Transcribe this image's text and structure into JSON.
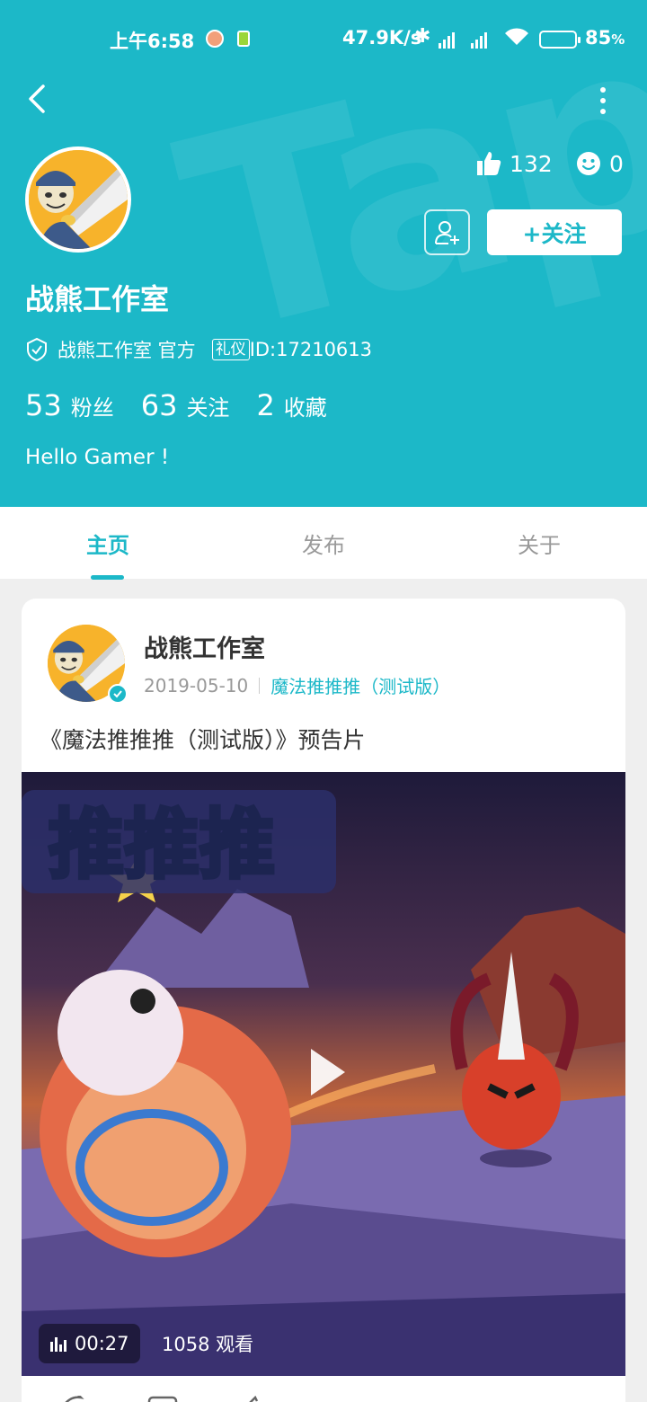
{
  "status_bar": {
    "time": "上午6:58",
    "net_speed": "47.9K/s",
    "battery": "85",
    "battery_unit": "%"
  },
  "profile": {
    "name": "战熊工作室",
    "likes": "132",
    "reactions": "0",
    "follow_label": "+关注",
    "verify_text": "战熊工作室 官方",
    "etiquette_label": "礼仪",
    "id_text": "ID:17210613",
    "fans_count": "53",
    "fans_label": "粉丝",
    "following_count": "63",
    "following_label": "关注",
    "favorites_count": "2",
    "favorites_label": "收藏",
    "bio": "Hello Gamer !"
  },
  "tabs": [
    {
      "label": "主页",
      "active": true
    },
    {
      "label": "发布",
      "active": false
    },
    {
      "label": "关于",
      "active": false
    }
  ],
  "post": {
    "author": "战熊工作室",
    "date": "2019-05-10",
    "game": "魔法推推推（测试版）",
    "title": "《魔法推推推（测试版）》预告片",
    "video_title_text": "推推推",
    "duration": "00:27",
    "views": "1058 观看"
  },
  "colors": {
    "accent": "#1cb8c8",
    "header_bg": "#1cb8c8",
    "page_bg": "#efefef"
  },
  "icons": {
    "back": "chevron-left-icon",
    "more": "more-vertical-icon",
    "like": "thumbs-up-icon",
    "smile": "smile-icon",
    "add_friend": "add-friend-icon",
    "verified": "shield-check-icon",
    "play": "play-icon",
    "chart": "bar-chart-icon"
  }
}
